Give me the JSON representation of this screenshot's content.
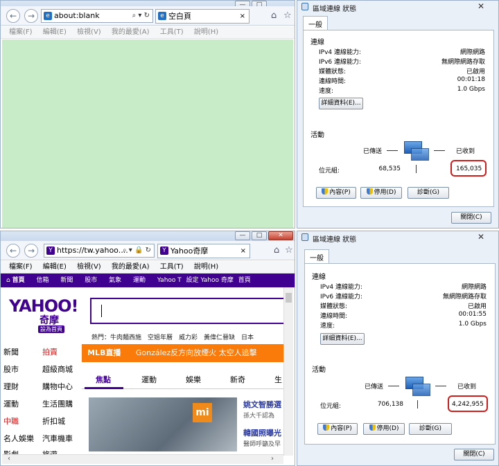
{
  "colors": {
    "blank_page": "#c8ebc8",
    "yahoo_purple": "#400090",
    "mlb_orange": "#fa7b0a",
    "highlight_red": "#d21c1c"
  },
  "browser_top": {
    "address": "about:blank",
    "addr_tools": "⌕ ▾ ↻",
    "tab_title": "空白頁",
    "tab_close": "×",
    "menu": [
      "檔案(F)",
      "編輯(E)",
      "檢視(V)",
      "我的最愛(A)",
      "工具(T)",
      "說明(H)"
    ]
  },
  "browser_bottom": {
    "address": "https://tw.yahoo....",
    "addr_tools": "⌕ ▾ 🔒 ↻",
    "tab_title": "Yahoo奇摩",
    "tab_close": "×",
    "menu": [
      "檔案(F)",
      "編輯(E)",
      "檢視(V)",
      "我的最愛(A)",
      "工具(T)",
      "說明(H)"
    ],
    "win_min": "—",
    "win_max": "□",
    "win_close": "✕",
    "yahoo": {
      "navbar": [
        "首頁",
        "信箱",
        "新聞",
        "股市",
        "氣象",
        "運動",
        "Yahoo T",
        "設定 Yahoo 奇摩",
        "首頁"
      ],
      "logo": "YAHOO!",
      "logo_sub": "奇摩",
      "logo_badge": "設為首頁",
      "hot_label": "熱門：牛肉麵西施　空姐年曆　威力彩　黃偉仁晉缺　日本",
      "side_left": [
        "新聞",
        "股市",
        "理財",
        "運動",
        "中職",
        "名人娛樂",
        "影劇"
      ],
      "side_right": [
        "拍賣",
        "超級商城",
        "購物中心",
        "生活團購",
        "折扣城",
        "汽車機車",
        "旅遊"
      ],
      "mlb_tag": "MLB直播",
      "mlb_text": "González反方向放煙火 太空人追擊",
      "cats": [
        "焦點",
        "運動",
        "娛樂",
        "新奇",
        "生"
      ],
      "mi_logo": "mi",
      "headlines": [
        {
          "title": "姚文智勝選",
          "sub": "孫大千認為"
        },
        {
          "title": "韓國照曝光",
          "sub": "醫師呼籲及早"
        }
      ]
    }
  },
  "dialog_top": {
    "title": "區域連線 狀態",
    "tab": "一般",
    "connection_title": "連線",
    "rows": [
      {
        "label": "IPv4 連線能力:",
        "value": "網際網路"
      },
      {
        "label": "IPv6 連線能力:",
        "value": "無網際網路存取"
      },
      {
        "label": "媒體狀態:",
        "value": "已啟用"
      },
      {
        "label": "連線時間:",
        "value": "00:01:18"
      },
      {
        "label": "速度:",
        "value": "1.0 Gbps"
      }
    ],
    "details": "詳細資料(E)...",
    "activity_title": "活動",
    "sent_label": "已傳送",
    "recv_label": "已收到",
    "bytes_label": "位元組:",
    "sent_value": "68,535",
    "recv_value": "165,035",
    "btn_props": "內容(P)",
    "btn_disable": "停用(D)",
    "btn_diag": "診斷(G)",
    "btn_close": "關閉(C)"
  },
  "dialog_bottom": {
    "title": "區域連線 狀態",
    "tab": "一般",
    "connection_title": "連線",
    "rows": [
      {
        "label": "IPv4 連線能力:",
        "value": "網際網路"
      },
      {
        "label": "IPv6 連線能力:",
        "value": "無網際網路存取"
      },
      {
        "label": "媒體狀態:",
        "value": "已啟用"
      },
      {
        "label": "連線時間:",
        "value": "00:01:55"
      },
      {
        "label": "速度:",
        "value": "1.0 Gbps"
      }
    ],
    "details": "詳細資料(E)...",
    "activity_title": "活動",
    "sent_label": "已傳送",
    "recv_label": "已收到",
    "bytes_label": "位元組:",
    "sent_value": "706,138",
    "recv_value": "4,242,955",
    "btn_props": "內容(P)",
    "btn_disable": "停用(D)",
    "btn_diag": "診斷(G)",
    "btn_close": "關閉(C)"
  }
}
